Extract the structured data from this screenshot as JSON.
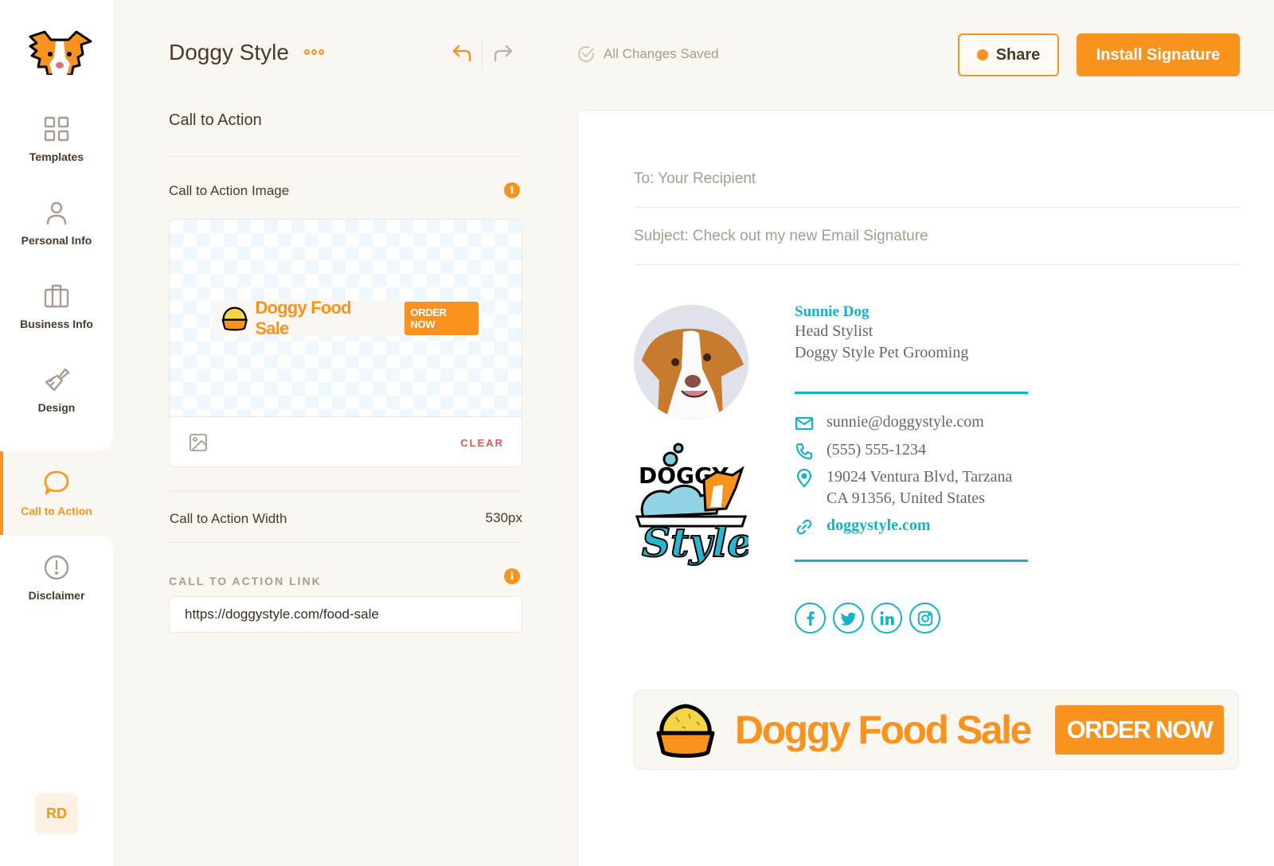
{
  "app": {
    "document_title": "Doggy Style",
    "save_status": "All Changes Saved",
    "share_label": "Share",
    "install_label": "Install Signature"
  },
  "sidebar": {
    "items": [
      {
        "label": "Templates",
        "icon": "grid-icon"
      },
      {
        "label": "Personal Info",
        "icon": "user-icon"
      },
      {
        "label": "Business Info",
        "icon": "briefcase-icon"
      },
      {
        "label": "Design",
        "icon": "paintbrush-icon"
      },
      {
        "label": "Call to Action",
        "icon": "chat-bubble-icon",
        "active": true
      },
      {
        "label": "Disclaimer",
        "icon": "alert-circle-icon"
      }
    ],
    "avatar_initials": "RD"
  },
  "panel": {
    "title": "Call to Action",
    "image_label": "Call to Action Image",
    "clear_label": "CLEAR",
    "width_label": "Call to Action Width",
    "width_value": "530px",
    "link_label": "CALL TO ACTION LINK",
    "link_value": "https://doggystyle.com/food-sale",
    "info_glyph": "i"
  },
  "cta": {
    "text": "Doggy Food Sale",
    "button": "ORDER NOW"
  },
  "preview": {
    "to_line": "To: Your Recipient",
    "subject_line": "Subject: Check out my new Email Signature",
    "signature": {
      "name": "Sunnie Dog",
      "title": "Head Stylist",
      "company": "Doggy Style Pet Grooming",
      "email": "sunnie@doggystyle.com",
      "phone": "(555) 555-1234",
      "address_line1": "19024 Ventura Blvd, Tarzana",
      "address_line2": "CA 91356, United States",
      "website": "doggystyle.com",
      "logo_word_top": "DOGGY",
      "logo_word_bottom": "Style",
      "social": [
        "facebook",
        "twitter",
        "linkedin",
        "instagram"
      ]
    }
  },
  "colors": {
    "accent": "#f7931e",
    "teal": "#14b2c9",
    "text": "#4a3a2a",
    "muted": "#a89c90",
    "danger": "#d35a5a",
    "background": "#faf6f2"
  }
}
